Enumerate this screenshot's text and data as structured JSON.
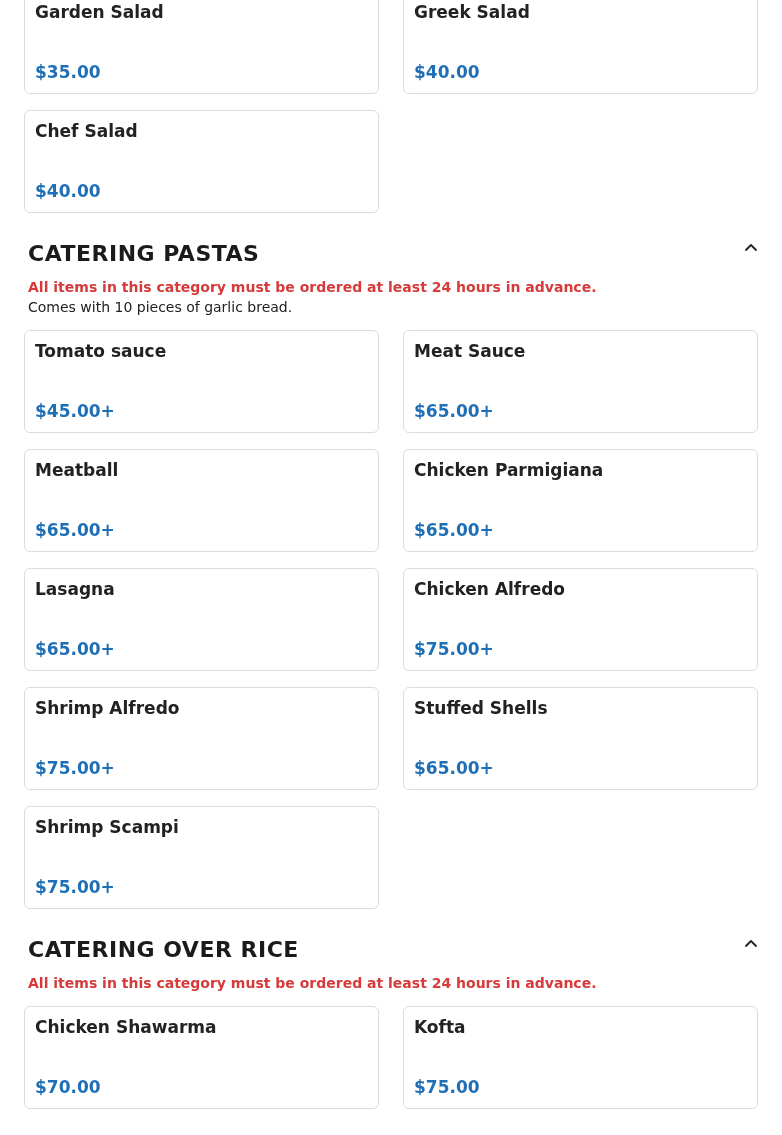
{
  "sections": [
    {
      "items": [
        {
          "name": "Garden Salad",
          "price": "$35.00"
        },
        {
          "name": "Greek Salad",
          "price": "$40.00"
        },
        {
          "name": "Chef Salad",
          "price": "$40.00"
        }
      ]
    },
    {
      "title": "CATERING PASTAS",
      "expanded": true,
      "notice": "All items in this category must be ordered at least 24 hours in advance.",
      "description": "Comes with 10 pieces of garlic bread.",
      "items": [
        {
          "name": "Tomato sauce",
          "price": "$45.00+"
        },
        {
          "name": "Meat Sauce",
          "price": "$65.00+"
        },
        {
          "name": "Meatball",
          "price": "$65.00+"
        },
        {
          "name": "Chicken Parmigiana",
          "price": "$65.00+"
        },
        {
          "name": "Lasagna",
          "price": "$65.00+"
        },
        {
          "name": "Chicken Alfredo",
          "price": "$75.00+"
        },
        {
          "name": "Shrimp Alfredo",
          "price": "$75.00+"
        },
        {
          "name": "Stuffed Shells",
          "price": "$65.00+"
        },
        {
          "name": "Shrimp Scampi",
          "price": "$75.00+"
        }
      ]
    },
    {
      "title": "CATERING OVER RICE",
      "expanded": true,
      "notice": "All items in this category must be ordered at least 24 hours in advance.",
      "items": [
        {
          "name": "Chicken Shawarma",
          "price": "$70.00"
        },
        {
          "name": "Kofta",
          "price": "$75.00"
        }
      ]
    }
  ]
}
